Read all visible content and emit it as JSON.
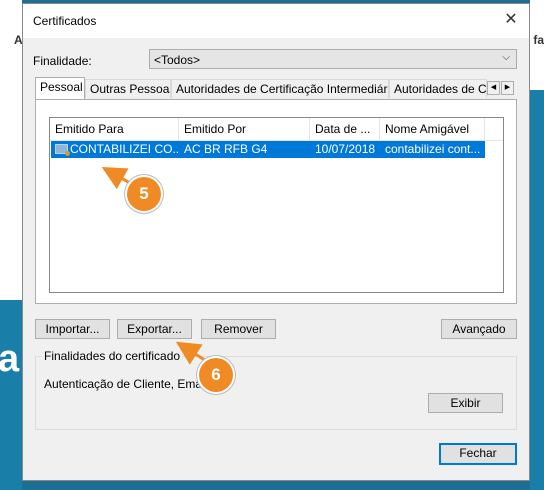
{
  "background": {
    "left_top_text": "A",
    "left_letter": "a",
    "right_top_text": "fa"
  },
  "window": {
    "title": "Certificados",
    "close_label": "✕"
  },
  "finalidade": {
    "label": "Finalidade:",
    "value": "<Todos>"
  },
  "tabs": [
    "Pessoal",
    "Outras Pessoas",
    "Autoridades de Certificação Intermediárias",
    "Autoridades de Ce"
  ],
  "tab_scroll": {
    "left": "◀",
    "right": "▶"
  },
  "list": {
    "columns": [
      "Emitido Para",
      "Emitido Por",
      "Data de ...",
      "Nome Amigável"
    ],
    "rows": [
      {
        "emitido_para": "CONTABILIZEI CO...",
        "emitido_por": "AC BR RFB G4",
        "data": "10/07/2018",
        "nome": "contabilizei cont..."
      }
    ]
  },
  "buttons": {
    "importar": "Importar...",
    "exportar": "Exportar...",
    "remover": "Remover",
    "avancado": "Avançado",
    "exibir": "Exibir",
    "fechar": "Fechar"
  },
  "finalidades_group": {
    "title": "Finalidades do certificado",
    "text": "Autenticação de Cliente, Email Se"
  },
  "callouts": [
    "5",
    "6"
  ],
  "colors": {
    "selection": "#0078d7",
    "callout": "#f08a24"
  }
}
